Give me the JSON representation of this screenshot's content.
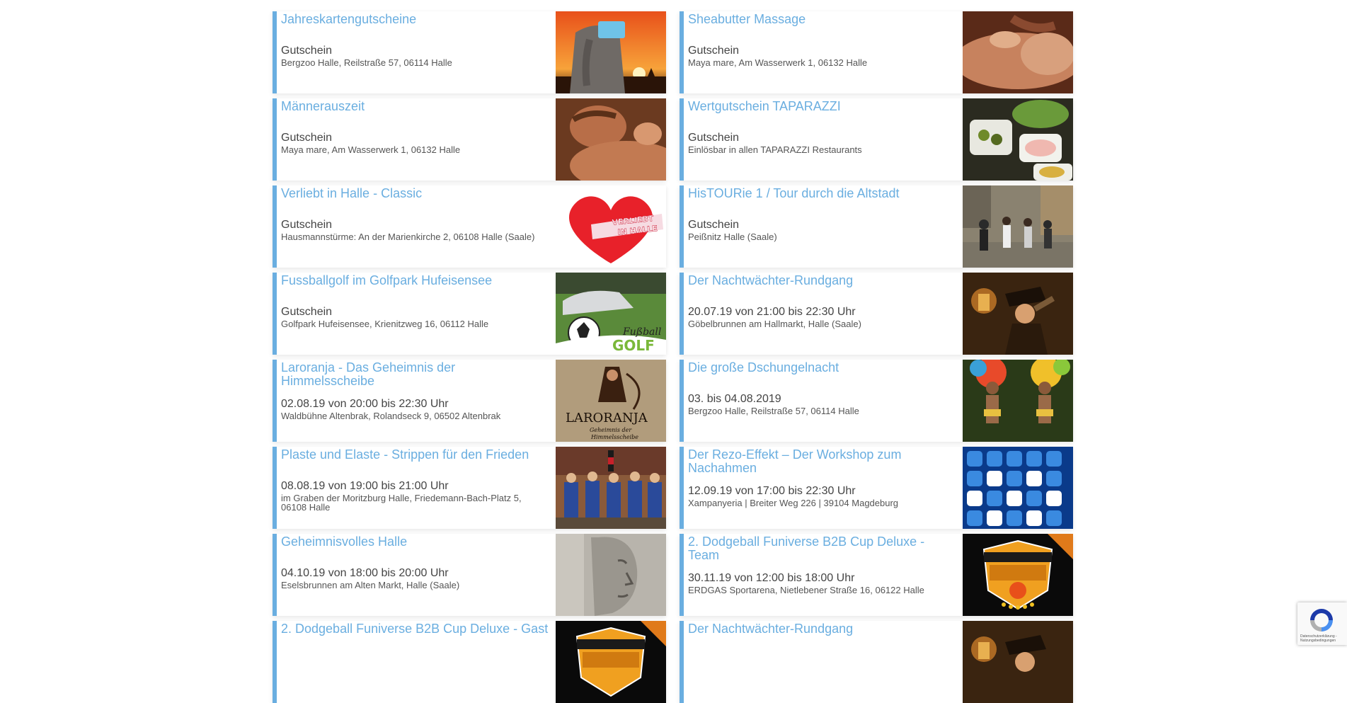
{
  "colors": {
    "accent": "#6aaee0",
    "text": "#444444",
    "background": "#ffffff"
  },
  "events": [
    {
      "title": "Jahreskartengutscheine",
      "when": "Gutschein",
      "where": "Bergzoo Halle, Reilstraße 57, 06114 Halle",
      "image": "elephant-sunset-image"
    },
    {
      "title": "Sheabutter Massage",
      "when": "Gutschein",
      "where": "Maya mare, Am Wasserwerk 1, 06132 Halle",
      "image": "massage-image"
    },
    {
      "title": "Männerauszeit",
      "when": "Gutschein",
      "where": "Maya mare, Am Wasserwerk 1, 06132 Halle",
      "image": "man-massage-image"
    },
    {
      "title": "Wertgutschein TAPARAZZI",
      "when": "Gutschein",
      "where": "Einlösbar in allen TAPARAZZI Restaurants",
      "image": "tapas-image"
    },
    {
      "title": "Verliebt in Halle - Classic",
      "when": "Gutschein",
      "where": "Hausmannstürme: An der Marienkirche 2, 06108 Halle (Saale)",
      "image": "heart-logo-image",
      "image_text": "VERLIEBT IN HALLE"
    },
    {
      "title": "HisTOURie 1 / Tour durch die Altstadt",
      "when": "Gutschein",
      "where": "Peißnitz Halle (Saale)",
      "image": "segway-tour-image"
    },
    {
      "title": "Fussballgolf im Golfpark Hufeisensee",
      "when": "Gutschein",
      "where": "Golfpark Hufeisensee, Krienitzweg 16, 06112 Halle",
      "image": "footballgolf-image"
    },
    {
      "title": "Der Nachtwächter-Rundgang",
      "when": "20.07.19 von 21:00 bis 22:30 Uhr",
      "where": "Göbelbrunnen am Hallmarkt, Halle (Saale)",
      "image": "night-watchman-image"
    },
    {
      "title": "Laroranja - Das Geheimnis der Himmelsscheibe",
      "when": "02.08.19 von 20:00 bis 22:30 Uhr",
      "where": "Waldbühne Altenbrak, Rolandseck 9, 06502 Altenbrak",
      "image": "laroranja-poster-image"
    },
    {
      "title": "Die große Dschungelnacht",
      "when": "03. bis 04.08.2019",
      "where": "Bergzoo Halle, Reilstraße 57, 06114 Halle",
      "image": "samba-dancers-image"
    },
    {
      "title": "Plaste und Elaste - Strippen für den Frieden",
      "when": "08.08.19 von 19:00 bis 21:00 Uhr",
      "where": "im Graben der Moritzburg Halle, Friedemann-Bach-Platz 5, 06108 Halle",
      "image": "performers-image"
    },
    {
      "title": "Der Rezo-Effekt – Der Workshop zum Nachahmen",
      "when": "12.09.19 von 17:00 bis 22:30 Uhr",
      "where": "Xampanyeria | Breiter Weg 226 | 39104 Magdeburg",
      "image": "app-icons-image"
    },
    {
      "title": "Geheimnisvolles Halle",
      "when": "04.10.19 von 18:00 bis 20:00 Uhr",
      "where": "Eselsbrunnen am Alten Markt, Halle (Saale)",
      "image": "stone-face-image"
    },
    {
      "title": "2. Dodgeball Funiverse B2B Cup Deluxe - Team",
      "when": "30.11.19 von 12:00 bis 18:00 Uhr",
      "where": "ERDGAS Sportarena, Nietlebener Straße 16, 06122 Halle",
      "image": "dodgeball-badge-image"
    },
    {
      "title": "2. Dodgeball Funiverse B2B Cup Deluxe - Gast",
      "when": "",
      "where": "",
      "image": "dodgeball-badge-image"
    },
    {
      "title": "Der Nachtwächter-Rundgang",
      "when": "",
      "where": "",
      "image": "night-watchman-image"
    }
  ],
  "recaptcha": {
    "label": "Datenschutzerklärung - Nutzungsbedingungen"
  }
}
